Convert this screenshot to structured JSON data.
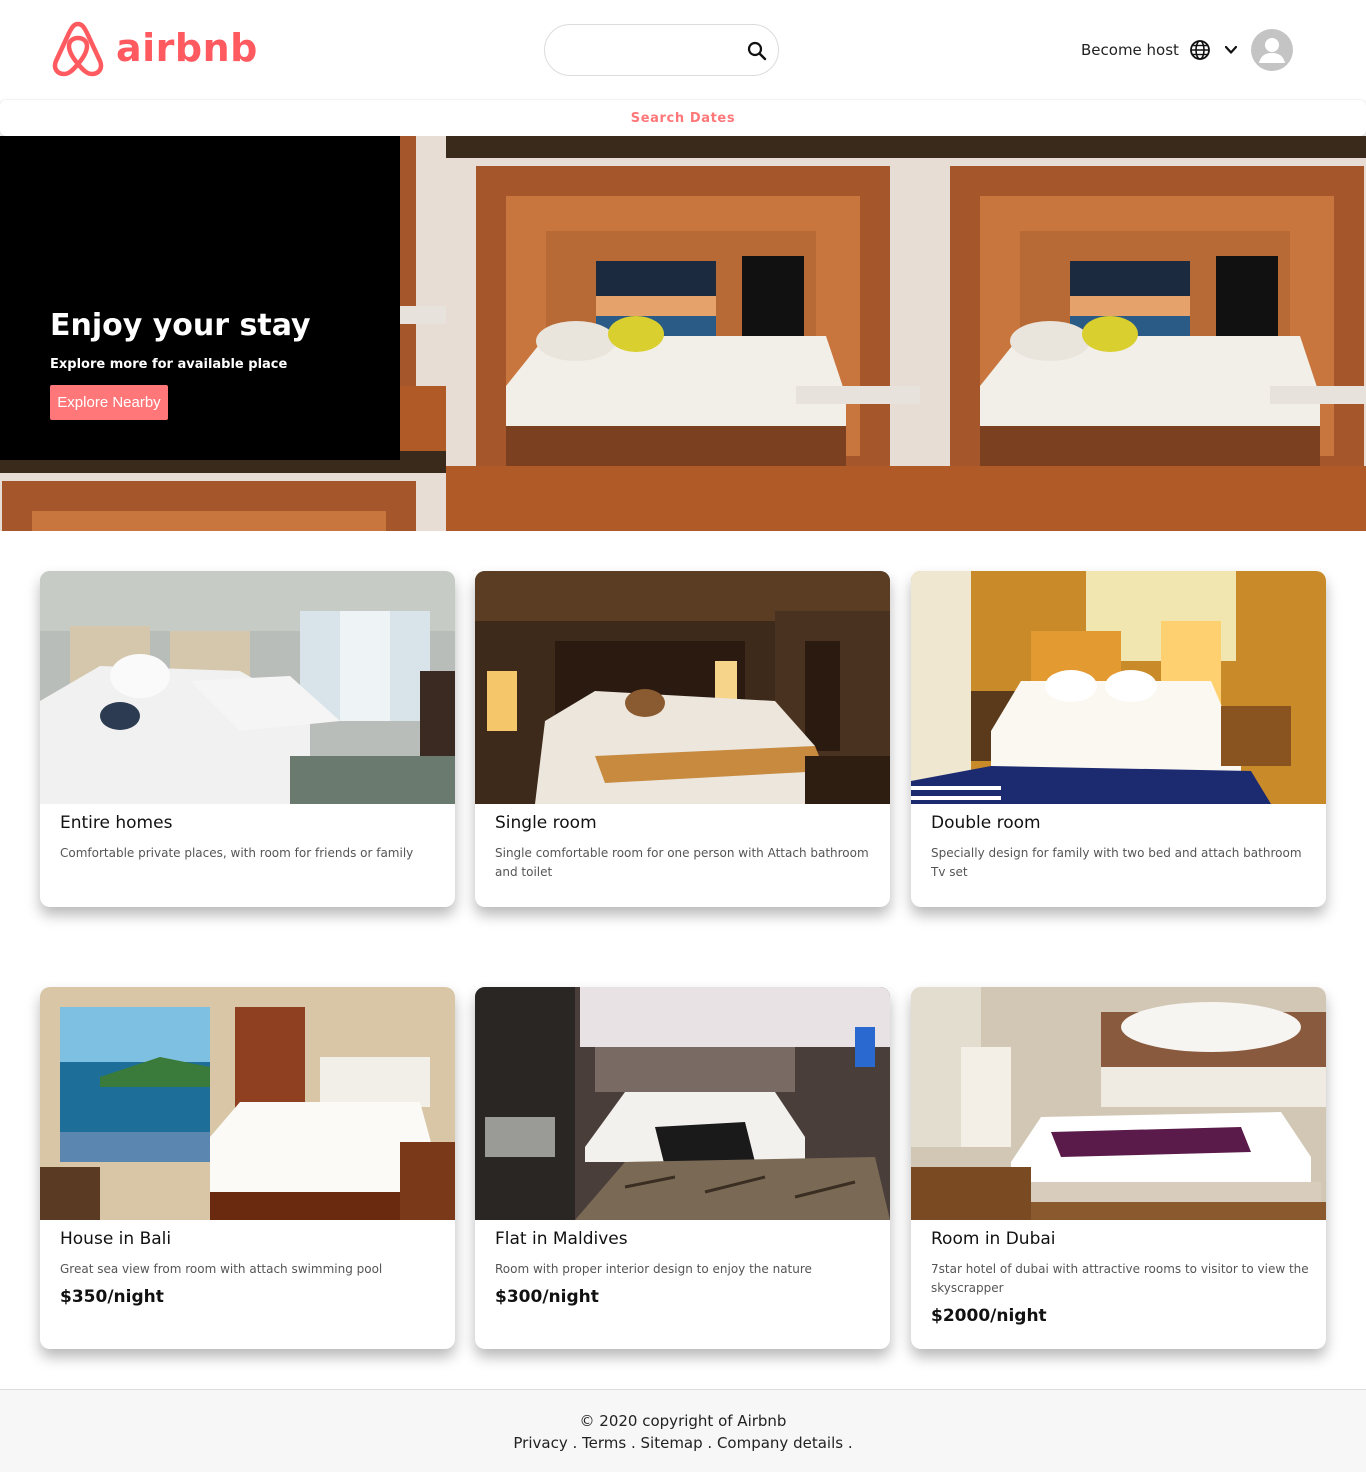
{
  "header": {
    "logo_text": "airbnb",
    "search": {
      "value": "",
      "placeholder": ""
    },
    "become_host": "Become host",
    "icons": [
      "airbnb-logo-icon",
      "search-icon",
      "globe-icon",
      "chevron-down-icon",
      "user-avatar-icon"
    ]
  },
  "dates_bar": {
    "label": "Search Dates"
  },
  "hero": {
    "title": "Enjoy your stay",
    "subtitle": "Explore more for available place",
    "button": "Explore Nearby"
  },
  "cards": [
    {
      "title": "Entire homes",
      "description": "Comfortable private places, with room for friends or family",
      "price": ""
    },
    {
      "title": "Single room",
      "description": "Single comfortable room for one person with Attach bathroom and toilet",
      "price": ""
    },
    {
      "title": "Double room",
      "description": "Specially design for family with two bed and attach bathroom Tv set",
      "price": ""
    },
    {
      "title": "House in Bali",
      "description": "Great sea view from room with attach swimming pool",
      "price": "$350/night"
    },
    {
      "title": "Flat in Maldives",
      "description": "Room with proper interior design to enjoy the nature",
      "price": "$300/night"
    },
    {
      "title": "Room in Dubai",
      "description": "7star hotel of dubai with attractive rooms to visitor to view the skyscrapper",
      "price": "$2000/night"
    }
  ],
  "footer": {
    "copyright": "© 2020 copyright of Airbnb",
    "links": [
      "Privacy",
      "Terms",
      "Sitemap",
      "Company details"
    ],
    "separator": " . ",
    "trailing": " ."
  },
  "colors": {
    "brand": "#ff5a5f",
    "button": "#ff7779",
    "hero_card": "#000000",
    "footer_bg": "#f7f7f7"
  }
}
